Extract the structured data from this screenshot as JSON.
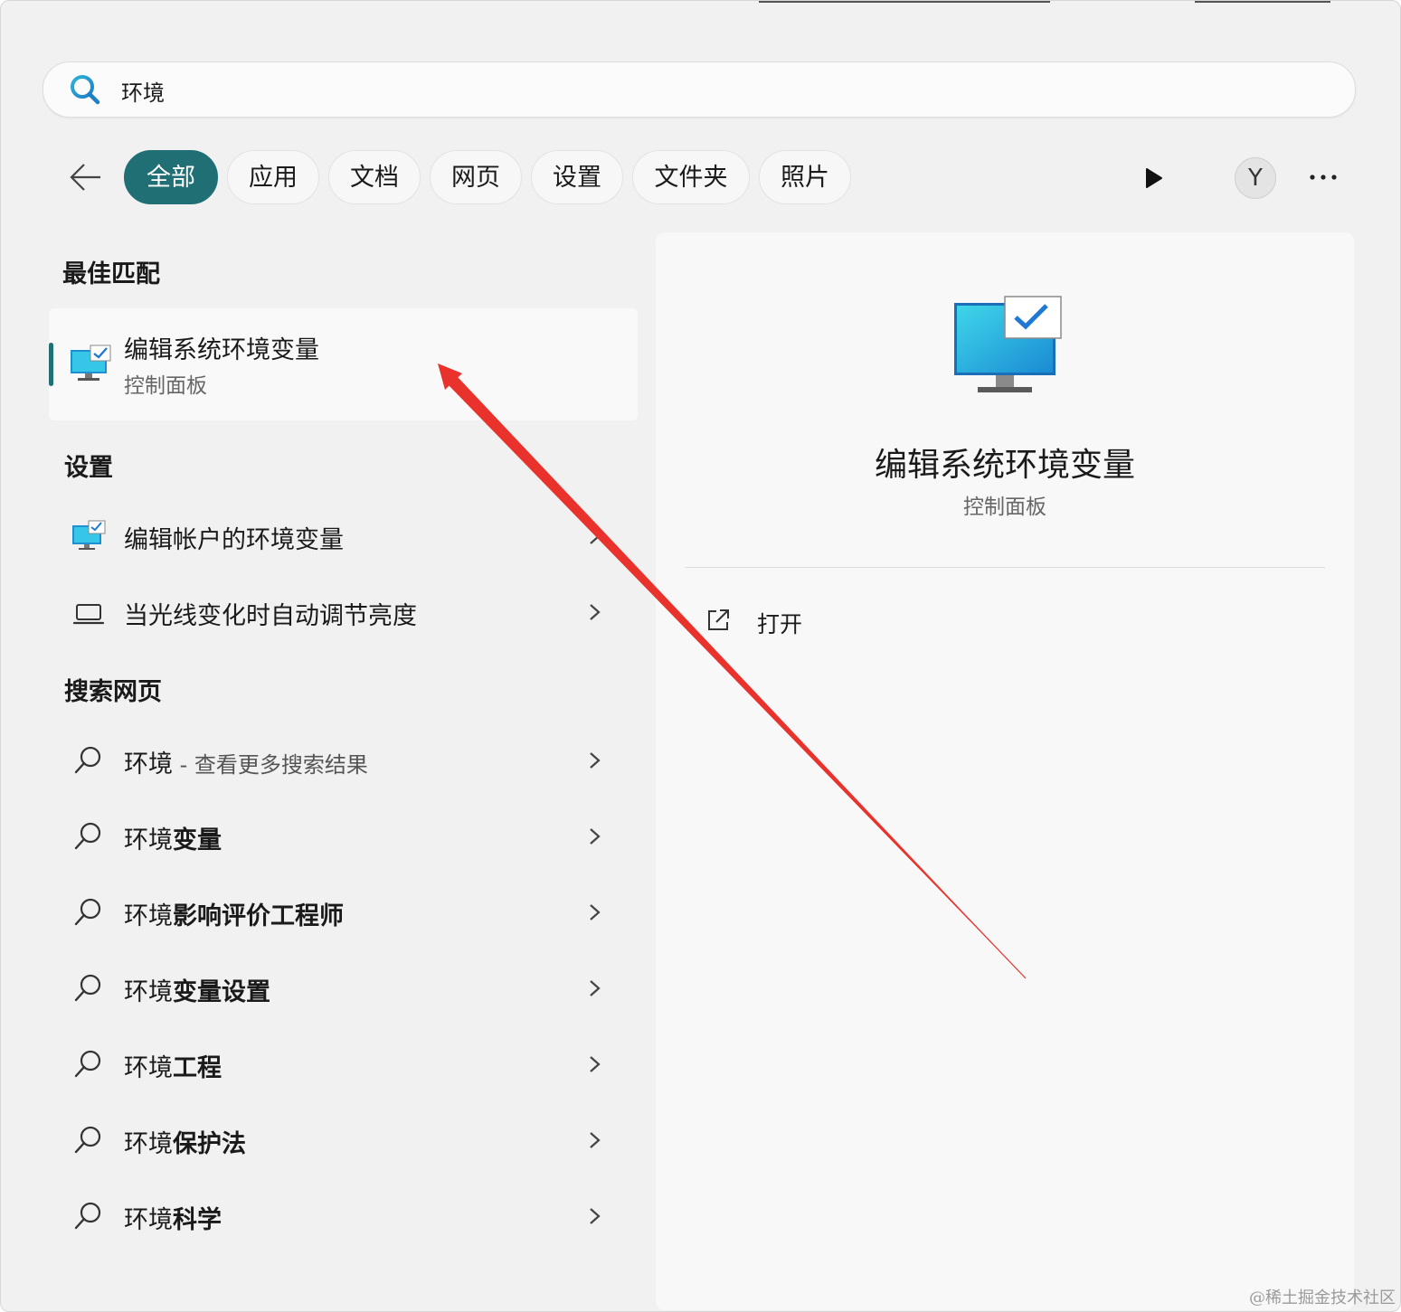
{
  "search": {
    "value": "环境"
  },
  "filters": {
    "back_label": "←",
    "chips": [
      "全部",
      "应用",
      "文档",
      "网页",
      "设置",
      "文件夹",
      "照片"
    ],
    "avatar_letter": "Y",
    "more_label": "···"
  },
  "best_match": {
    "heading": "最佳匹配",
    "title": "编辑系统环境变量",
    "subtitle": "控制面板"
  },
  "settings": {
    "heading": "设置",
    "items": [
      {
        "label": "编辑帐户的环境变量",
        "icon": "monitor-check-icon"
      },
      {
        "label": "当光线变化时自动调节亮度",
        "icon": "laptop-icon"
      }
    ]
  },
  "web": {
    "heading": "搜索网页",
    "first": {
      "query": "环境",
      "hint": " - 查看更多搜索结果"
    },
    "items": [
      {
        "prefix": "环境",
        "bold": "变量"
      },
      {
        "prefix": "环境",
        "bold": "影响评价工程师"
      },
      {
        "prefix": "环境",
        "bold": "变量设置"
      },
      {
        "prefix": "环境",
        "bold": "工程"
      },
      {
        "prefix": "环境",
        "bold": "保护法"
      },
      {
        "prefix": "环境",
        "bold": "科学"
      }
    ]
  },
  "detail": {
    "title": "编辑系统环境变量",
    "subtitle": "控制面板",
    "action_label": "打开"
  },
  "colors": {
    "accent": "#1f6f74",
    "annotation_arrow": "#e8322b"
  },
  "watermark": "@稀土掘金技术社区"
}
